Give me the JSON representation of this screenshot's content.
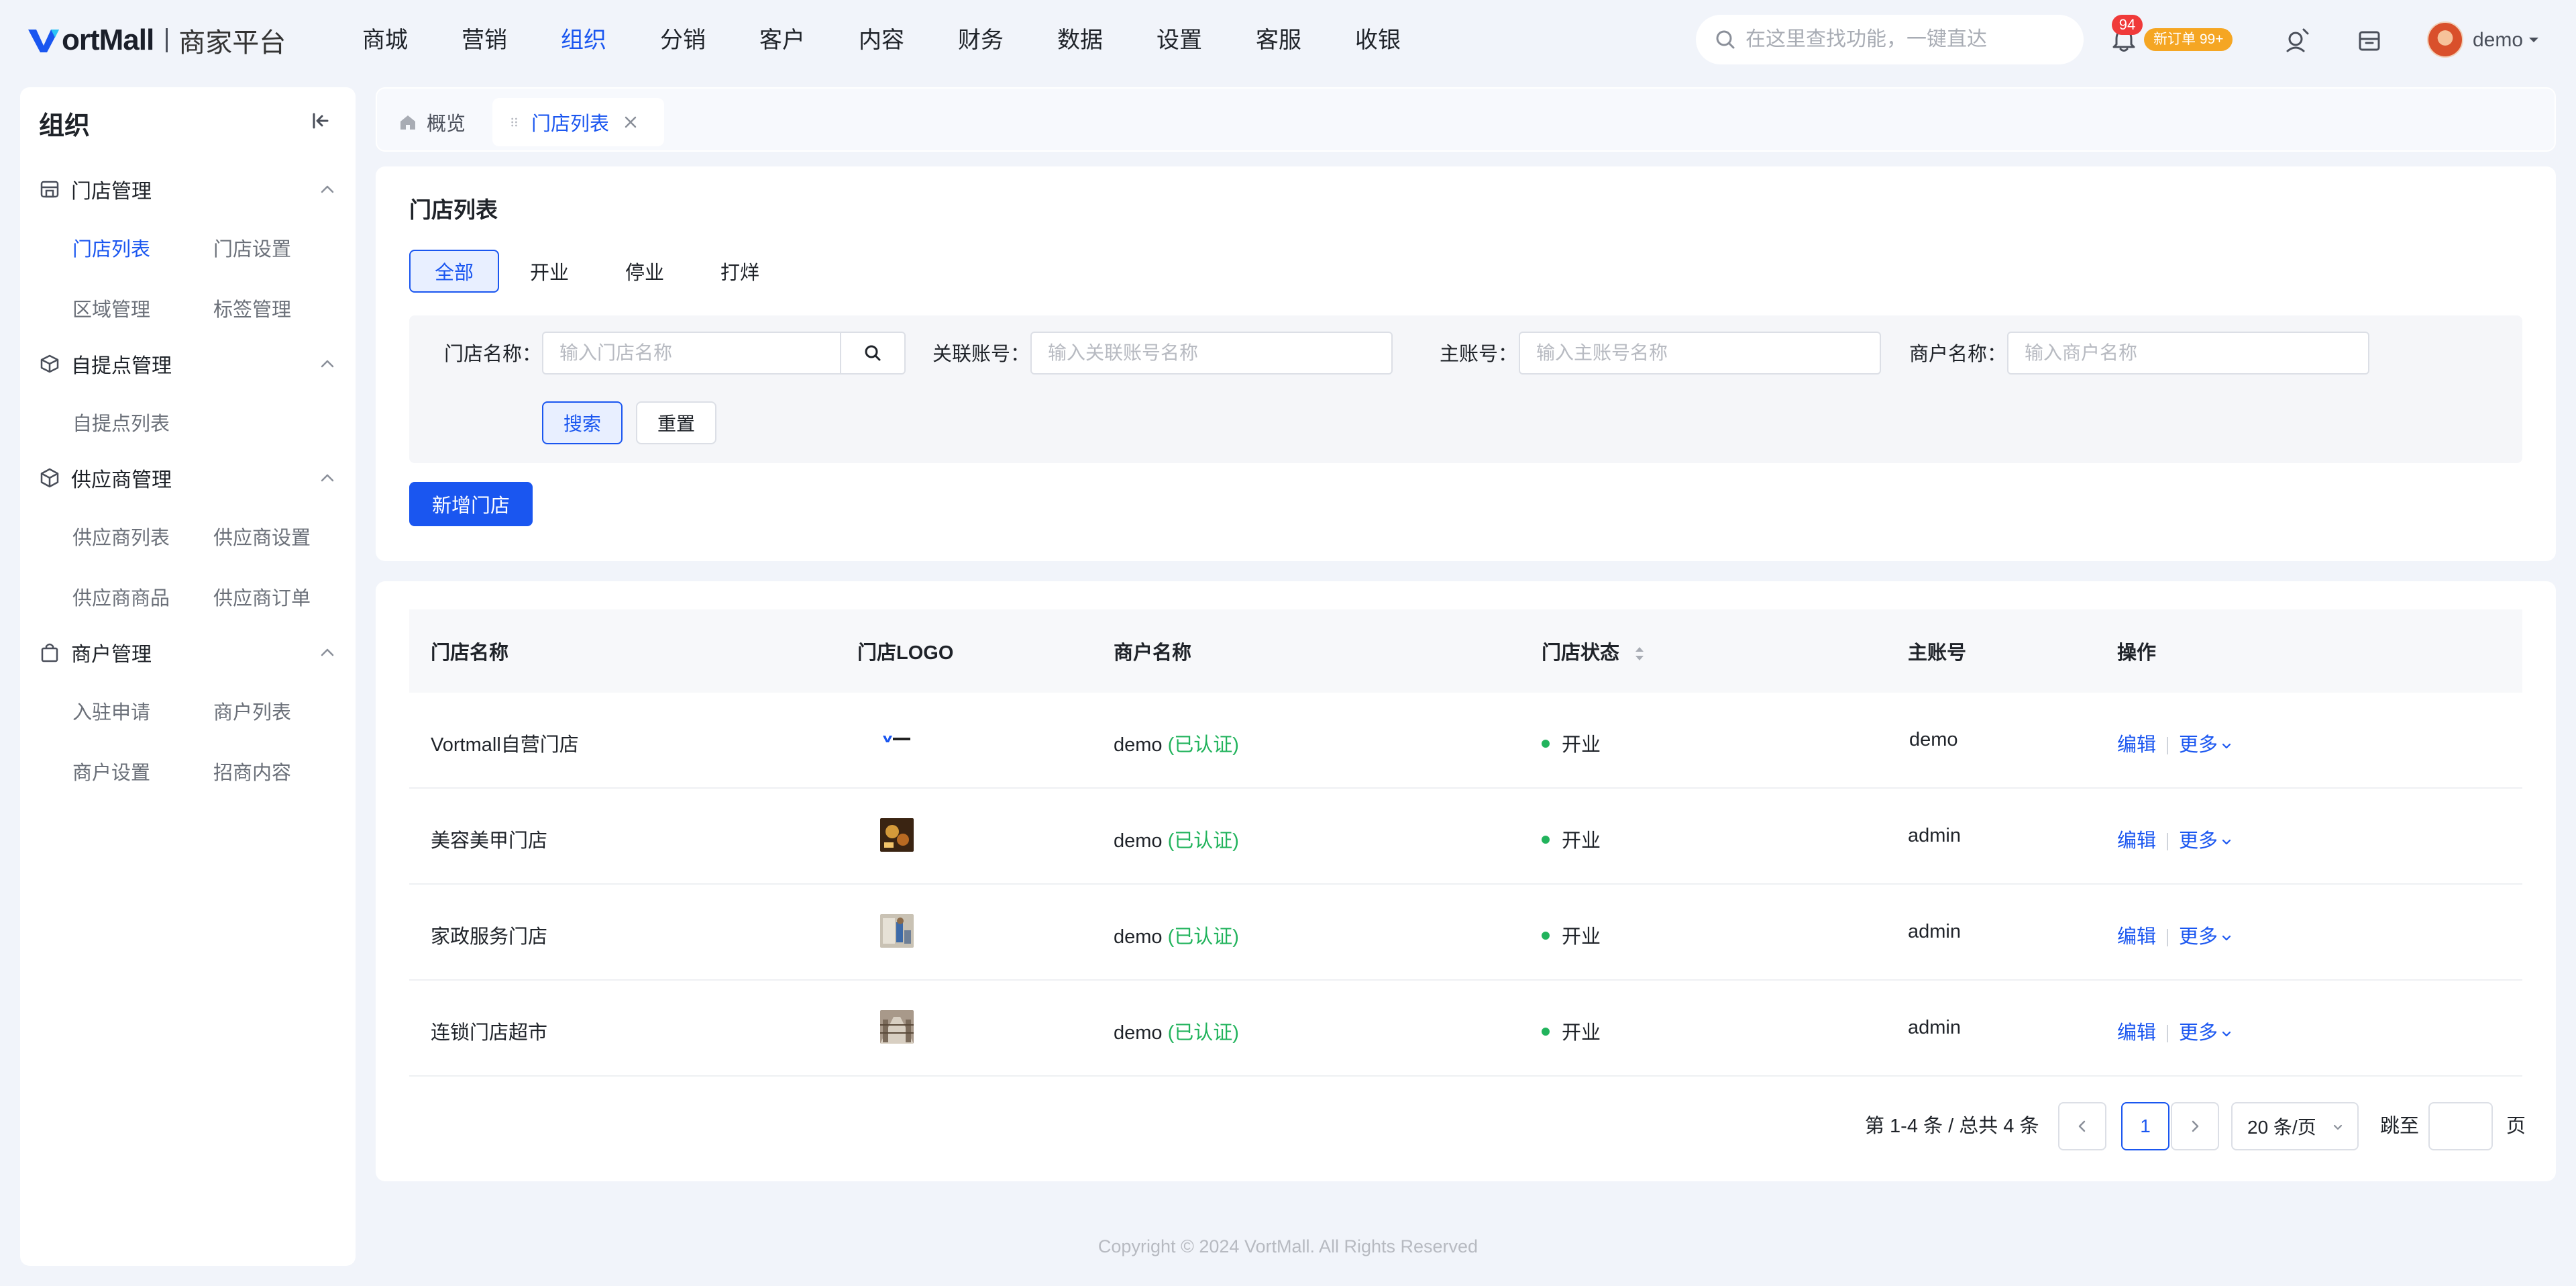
{
  "brand": {
    "logo_text": "ortMall",
    "subtitle": "商家平台"
  },
  "topnav": [
    "商城",
    "营销",
    "组织",
    "分销",
    "客户",
    "内容",
    "财务",
    "数据",
    "设置",
    "客服",
    "收银"
  ],
  "topnav_active_index": 2,
  "search": {
    "placeholder": "在这里查找功能，一键直达"
  },
  "notifications": {
    "count": "94",
    "new_orders": "新订单 99+"
  },
  "user": {
    "name": "demo"
  },
  "sidebar": {
    "title": "组织",
    "groups": [
      {
        "label": "门店管理",
        "items": [
          "门店列表",
          "门店设置",
          "区域管理",
          "标签管理"
        ]
      },
      {
        "label": "自提点管理",
        "items": [
          "自提点列表"
        ]
      },
      {
        "label": "供应商管理",
        "items": [
          "供应商列表",
          "供应商设置",
          "供应商商品",
          "供应商订单"
        ]
      },
      {
        "label": "商户管理",
        "items": [
          "入驻申请",
          "商户列表",
          "商户设置",
          "招商内容"
        ]
      }
    ]
  },
  "tabs": {
    "home": "概览",
    "active": "门店列表"
  },
  "filter": {
    "title": "门店列表",
    "status_tabs": [
      "全部",
      "开业",
      "停业",
      "打烊"
    ],
    "fields": [
      {
        "label": "门店名称：",
        "placeholder": "输入门店名称"
      },
      {
        "label": "关联账号：",
        "placeholder": "输入关联账号名称"
      },
      {
        "label": "主账号：",
        "placeholder": "输入主账号名称"
      },
      {
        "label": "商户名称：",
        "placeholder": "输入商户名称"
      }
    ],
    "search_button": "搜索",
    "reset_button": "重置",
    "add_button": "新增门店"
  },
  "table": {
    "columns": [
      "门店名称",
      "门店LOGO",
      "商户名称",
      "门店状态",
      "主账号",
      "操作"
    ],
    "verified_label": "(已认证)",
    "edit_label": "编辑",
    "more_label": "更多",
    "rows": [
      {
        "name": "Vortmall自营门店",
        "logo": "vortmall-logo",
        "merchant": "demo",
        "status": "开业",
        "account": "demo"
      },
      {
        "name": "美容美甲门店",
        "logo": "beauty-photo",
        "merchant": "demo",
        "status": "开业",
        "account": "admin"
      },
      {
        "name": "家政服务门店",
        "logo": "housekeeping-photo",
        "merchant": "demo",
        "status": "开业",
        "account": "admin"
      },
      {
        "name": "连锁门店超市",
        "logo": "supermarket-photo",
        "merchant": "demo",
        "status": "开业",
        "account": "admin"
      }
    ]
  },
  "pagination": {
    "total_text": "第 1-4 条 / 总共 4 条",
    "current_page": "1",
    "page_size": "20 条/页",
    "jump_label": "跳至",
    "page_label": "页"
  },
  "footer": "Copyright © 2024 VortMall. All Rights Reserved",
  "colors": {
    "accent": "#1a56f0",
    "success": "#21b35c",
    "danger": "#f03a3a",
    "warning": "#f5a623"
  }
}
